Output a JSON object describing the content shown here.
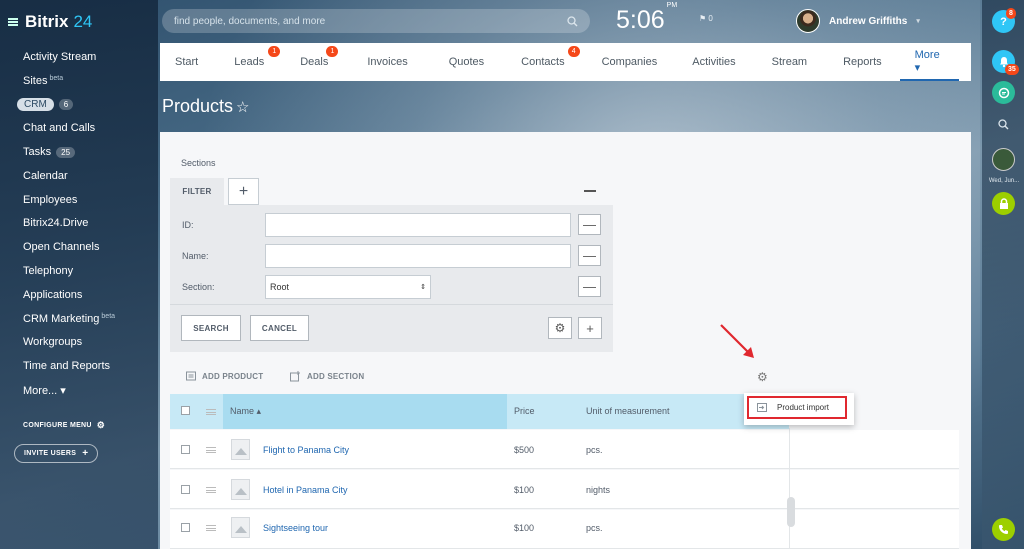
{
  "app": {
    "logo_main": "Bitrix",
    "logo_accent": "24"
  },
  "sidebar": {
    "items": [
      {
        "label": "Activity Stream"
      },
      {
        "label": "Sites",
        "sup": "beta"
      },
      {
        "label": "CRM",
        "count": "6",
        "pill": true
      },
      {
        "label": "Chat and Calls"
      },
      {
        "label": "Tasks",
        "count": "25"
      },
      {
        "label": "Calendar"
      },
      {
        "label": "Employees"
      },
      {
        "label": "Bitrix24.Drive"
      },
      {
        "label": "Open Channels"
      },
      {
        "label": "Telephony"
      },
      {
        "label": "Applications"
      },
      {
        "label": "CRM Marketing",
        "sup": "beta"
      },
      {
        "label": "Workgroups"
      },
      {
        "label": "Time and Reports"
      },
      {
        "label": "More... ▾"
      }
    ],
    "configure_menu": "CONFIGURE MENU",
    "invite_users": "INVITE USERS"
  },
  "topbar": {
    "search_placeholder": "find people, documents, and more",
    "time": "5:06",
    "ampm": "PM",
    "flag_count": "0",
    "user_name": "Andrew Griffiths"
  },
  "rightbar": {
    "help_badge": "8",
    "notify_badge": "35",
    "date_label": "Wed, Jun..."
  },
  "tabs": [
    {
      "label": "Start"
    },
    {
      "label": "Leads",
      "badge": "1"
    },
    {
      "label": "Deals",
      "badge": "1"
    },
    {
      "label": "Invoices"
    },
    {
      "label": "Quotes"
    },
    {
      "label": "Contacts",
      "badge": "4"
    },
    {
      "label": "Companies"
    },
    {
      "label": "Activities"
    },
    {
      "label": "Stream"
    },
    {
      "label": "Reports"
    }
  ],
  "tab_more": "More ▾",
  "page": {
    "title": "Products",
    "star": "☆"
  },
  "filter": {
    "sections_label": "Sections",
    "filter_tab": "FILTER",
    "plus": "+",
    "id_label": "ID:",
    "name_label": "Name:",
    "section_label": "Section:",
    "section_value": "Root",
    "search_btn": "SEARCH",
    "cancel_btn": "CANCEL"
  },
  "toolbar": {
    "add_product": "ADD PRODUCT",
    "add_section": "ADD SECTION"
  },
  "table": {
    "headers": {
      "name": "Name ▴",
      "price": "Price",
      "unit": "Unit of measurement"
    },
    "rows": [
      {
        "name": "Flight to Panama City",
        "price": "$500",
        "unit": "pcs."
      },
      {
        "name": "Hotel in Panama City",
        "price": "$100",
        "unit": "nights"
      },
      {
        "name": "Sightseeing tour",
        "price": "$100",
        "unit": "pcs."
      }
    ]
  },
  "popup": {
    "item": "Product import"
  },
  "colors": {
    "accent": "#2067b0",
    "badge": "#f54819",
    "highlight": "#e0282f",
    "header_blue": "#c7e9f6"
  }
}
